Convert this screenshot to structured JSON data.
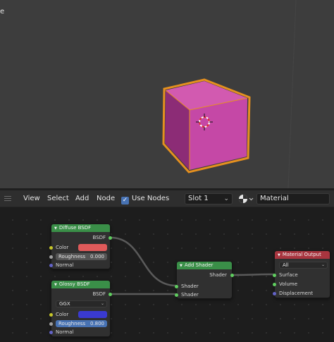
{
  "viewport": {
    "label": "e",
    "cube_color": "#c548a6",
    "outline_color": "#e5901f"
  },
  "header": {
    "menu": [
      "View",
      "Select",
      "Add",
      "Node"
    ],
    "use_nodes_label": "Use Nodes",
    "use_nodes_checked": true,
    "slot_label": "Slot 1",
    "material_name": "Material"
  },
  "nodes": {
    "diffuse": {
      "title": "Diffuse BSDF",
      "output": "BSDF",
      "color_label": "Color",
      "color_value": "#e05a5a",
      "roughness_label": "Roughness",
      "roughness_value": "0.000",
      "normal_label": "Normal"
    },
    "glossy": {
      "title": "Glossy BSDF",
      "output": "BSDF",
      "distribution": "GGX",
      "color_label": "Color",
      "color_value": "#3a3ad0",
      "roughness_label": "Roughness",
      "roughness_value": "0.800",
      "normal_label": "Normal"
    },
    "add_shader": {
      "title": "Add Shader",
      "output": "Shader",
      "input1": "Shader",
      "input2": "Shader"
    },
    "output": {
      "title": "Material Output",
      "target": "All",
      "surface": "Surface",
      "volume": "Volume",
      "displacement": "Displacement"
    }
  }
}
